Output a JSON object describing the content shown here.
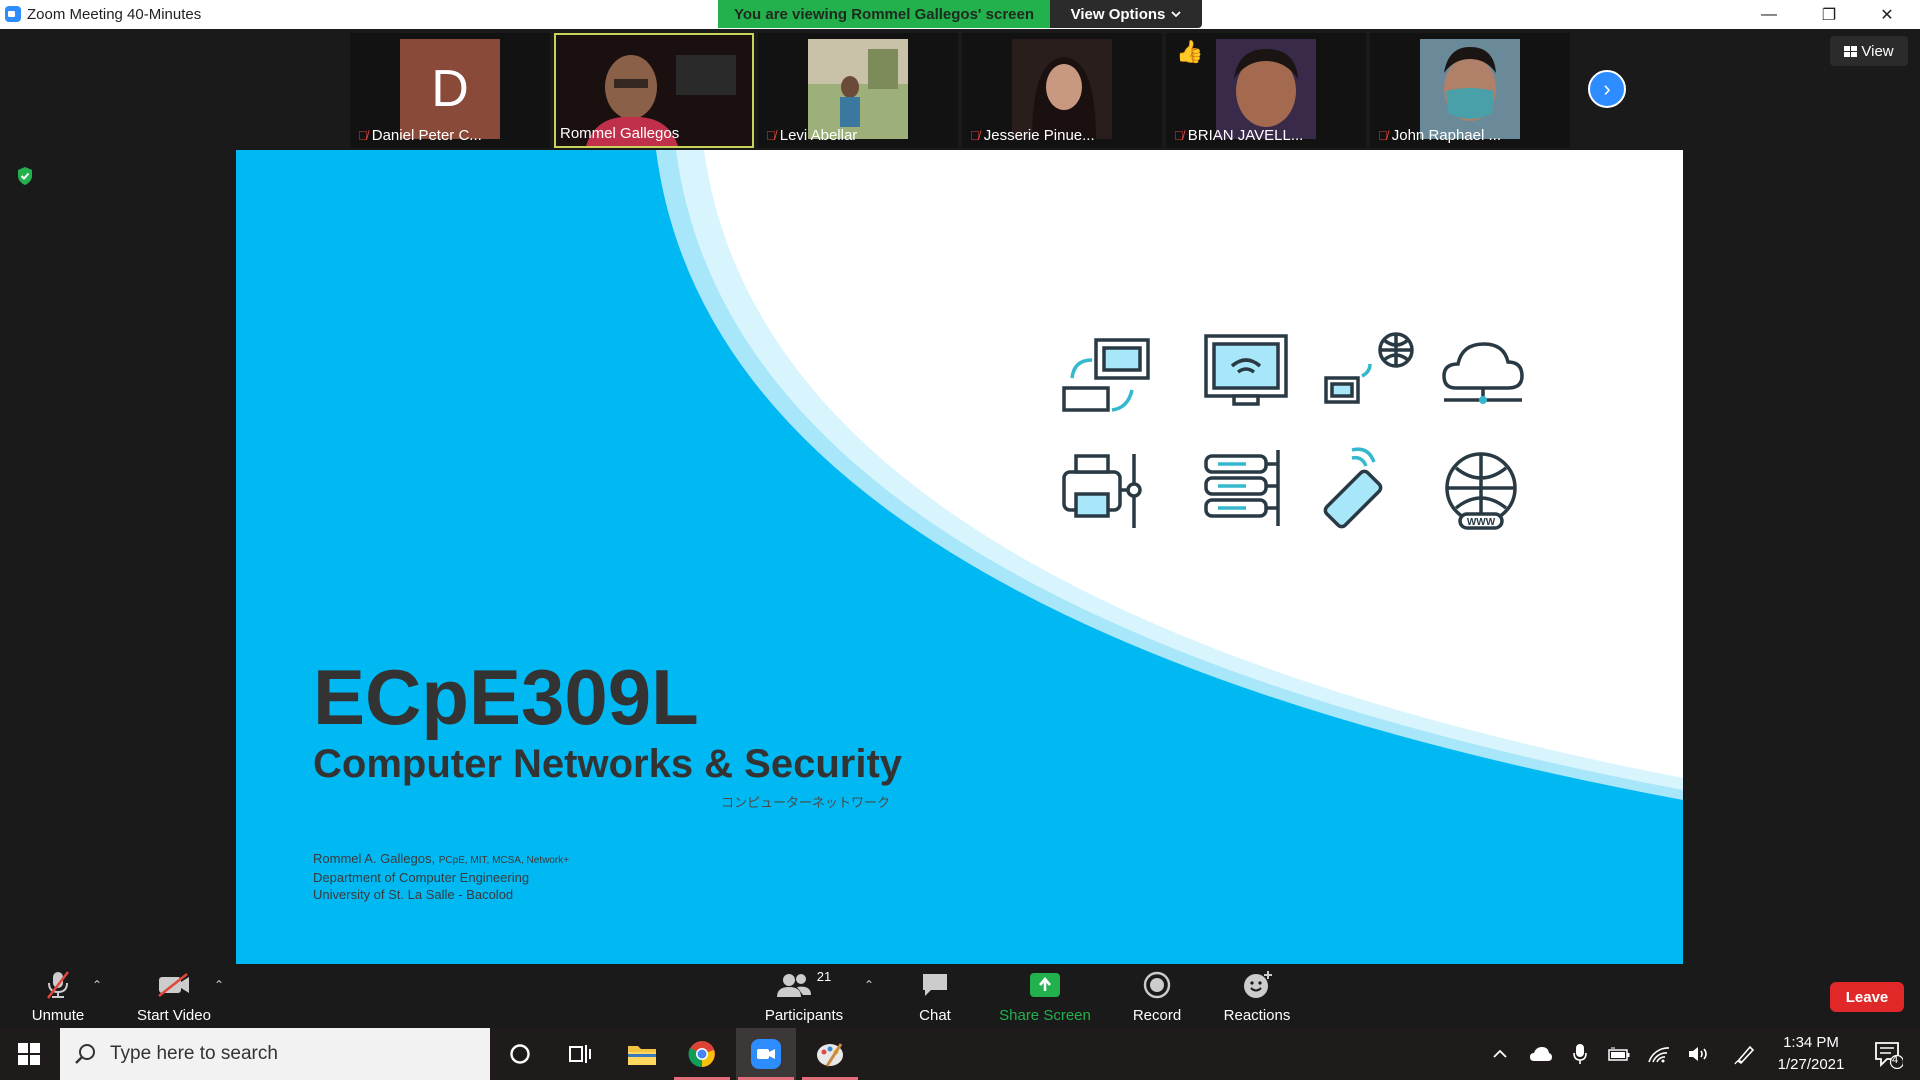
{
  "window": {
    "title": "Zoom Meeting 40-Minutes",
    "minimize": "—",
    "restore": "❐",
    "close": "✕"
  },
  "banner": {
    "viewing_text": "You are viewing Rommel Gallegos' screen",
    "view_options": "View Options"
  },
  "view_button": "View",
  "participants_strip": [
    {
      "name": "Daniel Peter C...",
      "initial": "D",
      "muted": true
    },
    {
      "name": "Rommel Gallegos",
      "muted": false,
      "active": true
    },
    {
      "name": "Levi Abellar",
      "muted": true
    },
    {
      "name": "Jesserie Pinue...",
      "muted": true
    },
    {
      "name": "BRIAN JAVELL...",
      "muted": true
    },
    {
      "name": "John Raphael ...",
      "muted": true
    }
  ],
  "slide": {
    "course_code": "ECpE309L",
    "course_title": "Computer Networks & Security",
    "japanese": "コンピューターネットワーク",
    "author_name": "Rommel A. Gallegos,",
    "author_credentials": "PCpE, MIT, MCSA, Network+",
    "department": "Department of Computer Engineering",
    "university": "University of St. La Salle - Bacolod",
    "icon_www": "WWW"
  },
  "toolbar": {
    "unmute": "Unmute",
    "start_video": "Start Video",
    "participants": "Participants",
    "participants_count": "21",
    "chat": "Chat",
    "share_screen": "Share Screen",
    "record": "Record",
    "reactions": "Reactions",
    "leave": "Leave"
  },
  "colors": {
    "slide_blue": "#00b9f2",
    "share_green": "#23b14d",
    "leave_red": "#e02828",
    "zoom_blue": "#2d8cff"
  },
  "taskbar": {
    "search_placeholder": "Type here to search",
    "time": "1:34 PM",
    "date": "1/27/2021",
    "notification_count": "4"
  }
}
